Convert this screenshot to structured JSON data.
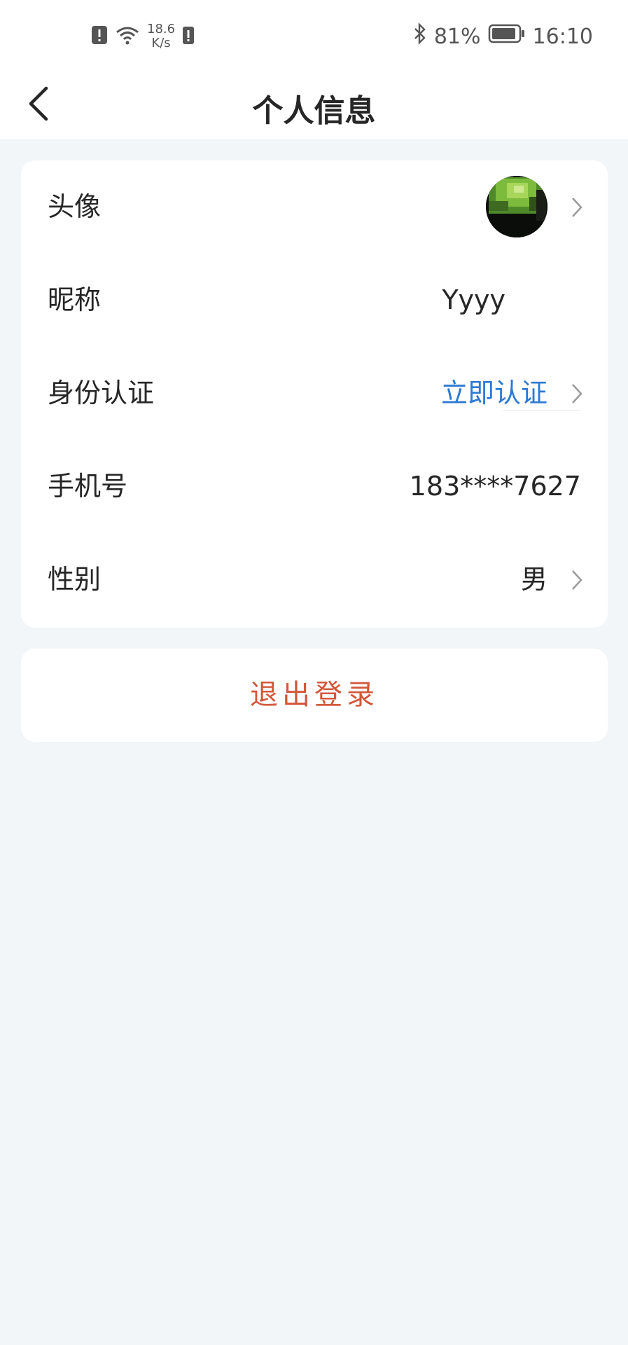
{
  "status_bar": {
    "net_speed_value": "18.6",
    "net_speed_unit": "K/s",
    "battery_percent": "81%",
    "time": "16:10"
  },
  "header": {
    "title": "个人信息"
  },
  "profile": {
    "avatar_label": "头像",
    "nickname_label": "昵称",
    "nickname_value": "Yyyy",
    "identity_label": "身份认证",
    "identity_action": "立即认证",
    "phone_label": "手机号",
    "phone_value": "183****7627",
    "gender_label": "性别",
    "gender_value": "男"
  },
  "logout": {
    "label": "退出登录"
  },
  "colors": {
    "accent_link": "#2d7ad2",
    "logout_text": "#d4573a",
    "page_background": "#f3f6f8"
  }
}
